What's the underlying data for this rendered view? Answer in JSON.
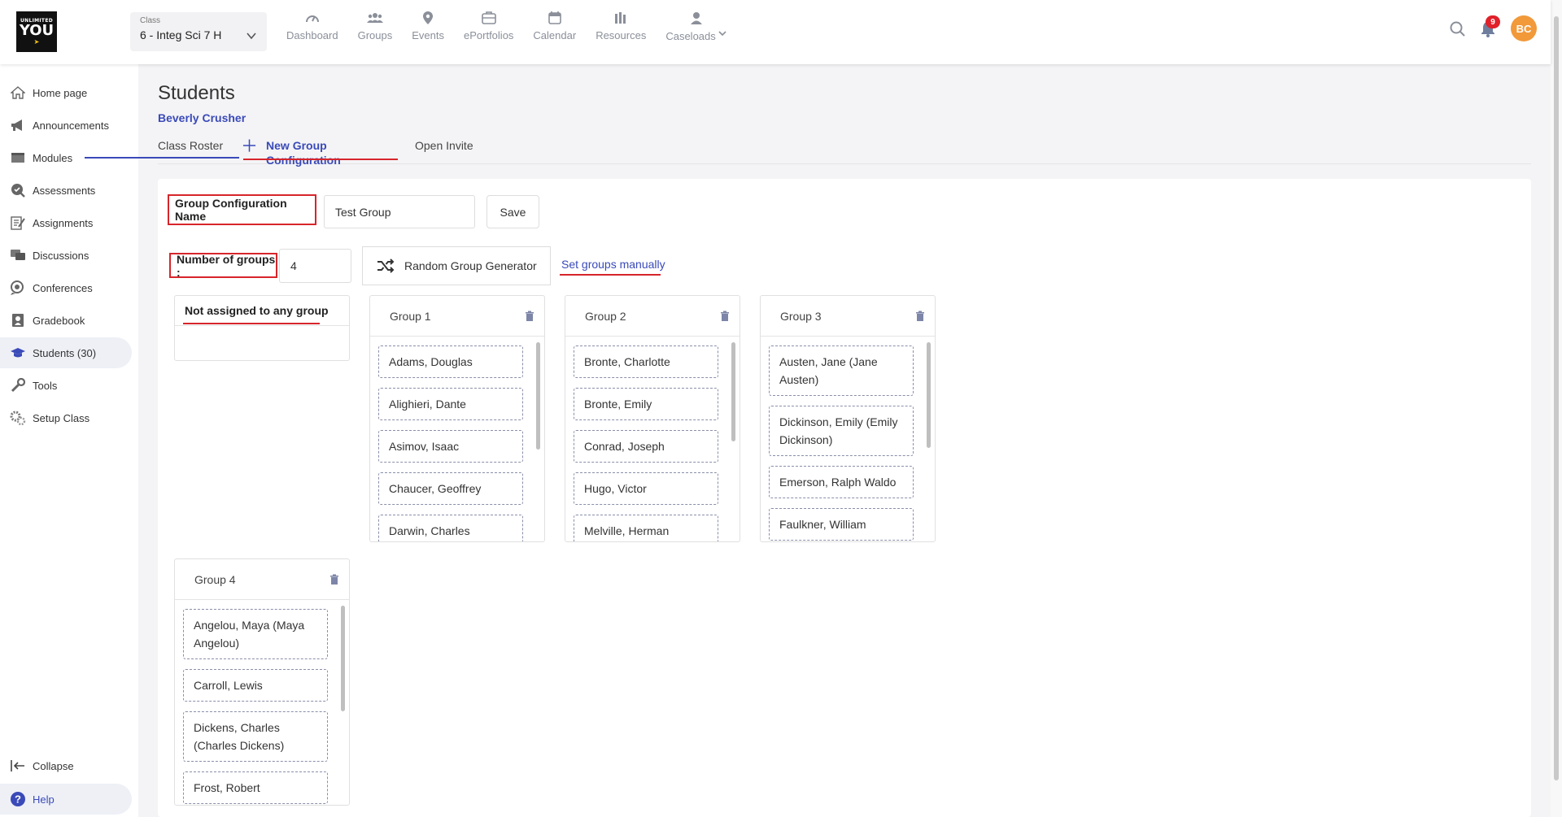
{
  "logo": {
    "line1": "UNLIMITED",
    "line2": "YOU"
  },
  "class_selector": {
    "caption": "Class",
    "value": "6 - Integ Sci 7 H"
  },
  "nav": [
    {
      "label": "Dashboard",
      "icon": "dashboard-icon"
    },
    {
      "label": "Groups",
      "icon": "groups-icon"
    },
    {
      "label": "Events",
      "icon": "map-pin-icon"
    },
    {
      "label": "ePortfolios",
      "icon": "portfolio-icon"
    },
    {
      "label": "Calendar",
      "icon": "calendar-icon"
    },
    {
      "label": "Resources",
      "icon": "resources-icon"
    },
    {
      "label": "Caseloads",
      "icon": "person-icon"
    }
  ],
  "notifications": {
    "count": "9"
  },
  "user": {
    "initials": "BC",
    "color": "#f2993a"
  },
  "sidebar": {
    "items": [
      {
        "label": "Home page",
        "icon": "home-icon"
      },
      {
        "label": "Announcements",
        "icon": "megaphone-icon"
      },
      {
        "label": "Modules",
        "icon": "modules-icon"
      },
      {
        "label": "Assessments",
        "icon": "assessments-icon"
      },
      {
        "label": "Assignments",
        "icon": "assignments-icon"
      },
      {
        "label": "Discussions",
        "icon": "discussions-icon"
      },
      {
        "label": "Conferences",
        "icon": "conferences-icon"
      },
      {
        "label": "Gradebook",
        "icon": "gradebook-icon"
      },
      {
        "label": "Students (30)",
        "icon": "graduation-cap-icon",
        "active": true
      },
      {
        "label": "Tools",
        "icon": "tools-icon"
      },
      {
        "label": "Setup Class",
        "icon": "gears-icon"
      }
    ],
    "collapse_label": "Collapse",
    "help_label": "Help"
  },
  "page": {
    "title": "Students",
    "subtitle": "Beverly Crusher",
    "tabs": [
      {
        "label": "Class Roster"
      },
      {
        "label": "New Group Configuration",
        "active": true
      },
      {
        "label": "Open Invite"
      }
    ]
  },
  "form": {
    "config_name_label": "Group Configuration Name",
    "config_name_value": "Test Group",
    "save_label": "Save",
    "num_groups_label": "Number of groups :",
    "num_groups_value": "4",
    "random_generator_label": "Random Group Generator",
    "set_manually_label": "Set groups manually"
  },
  "unassigned": {
    "title": "Not assigned to any group",
    "students": []
  },
  "groups": [
    {
      "name": "Group 1",
      "students": [
        "Adams, Douglas",
        "Alighieri, Dante",
        "Asimov, Isaac",
        "Chaucer, Geoffrey",
        "Darwin, Charles"
      ]
    },
    {
      "name": "Group 2",
      "students": [
        "Bronte, Charlotte",
        "Bronte, Emily",
        "Conrad, Joseph",
        "Hugo, Victor",
        "Melville, Herman"
      ]
    },
    {
      "name": "Group 3",
      "students": [
        "Austen, Jane (Jane Austen)",
        "Dickinson, Emily (Emily Dickinson)",
        "Emerson, Ralph Waldo",
        "Faulkner, William"
      ]
    },
    {
      "name": "Group 4",
      "students": [
        "Angelou, Maya (Maya Angelou)",
        "Carroll, Lewis",
        "Dickens, Charles (Charles Dickens)",
        "Frost, Robert"
      ]
    }
  ],
  "colors": {
    "accent": "#3a4ab8",
    "highlight_red": "#d7252b",
    "badge": "#e0202a"
  }
}
